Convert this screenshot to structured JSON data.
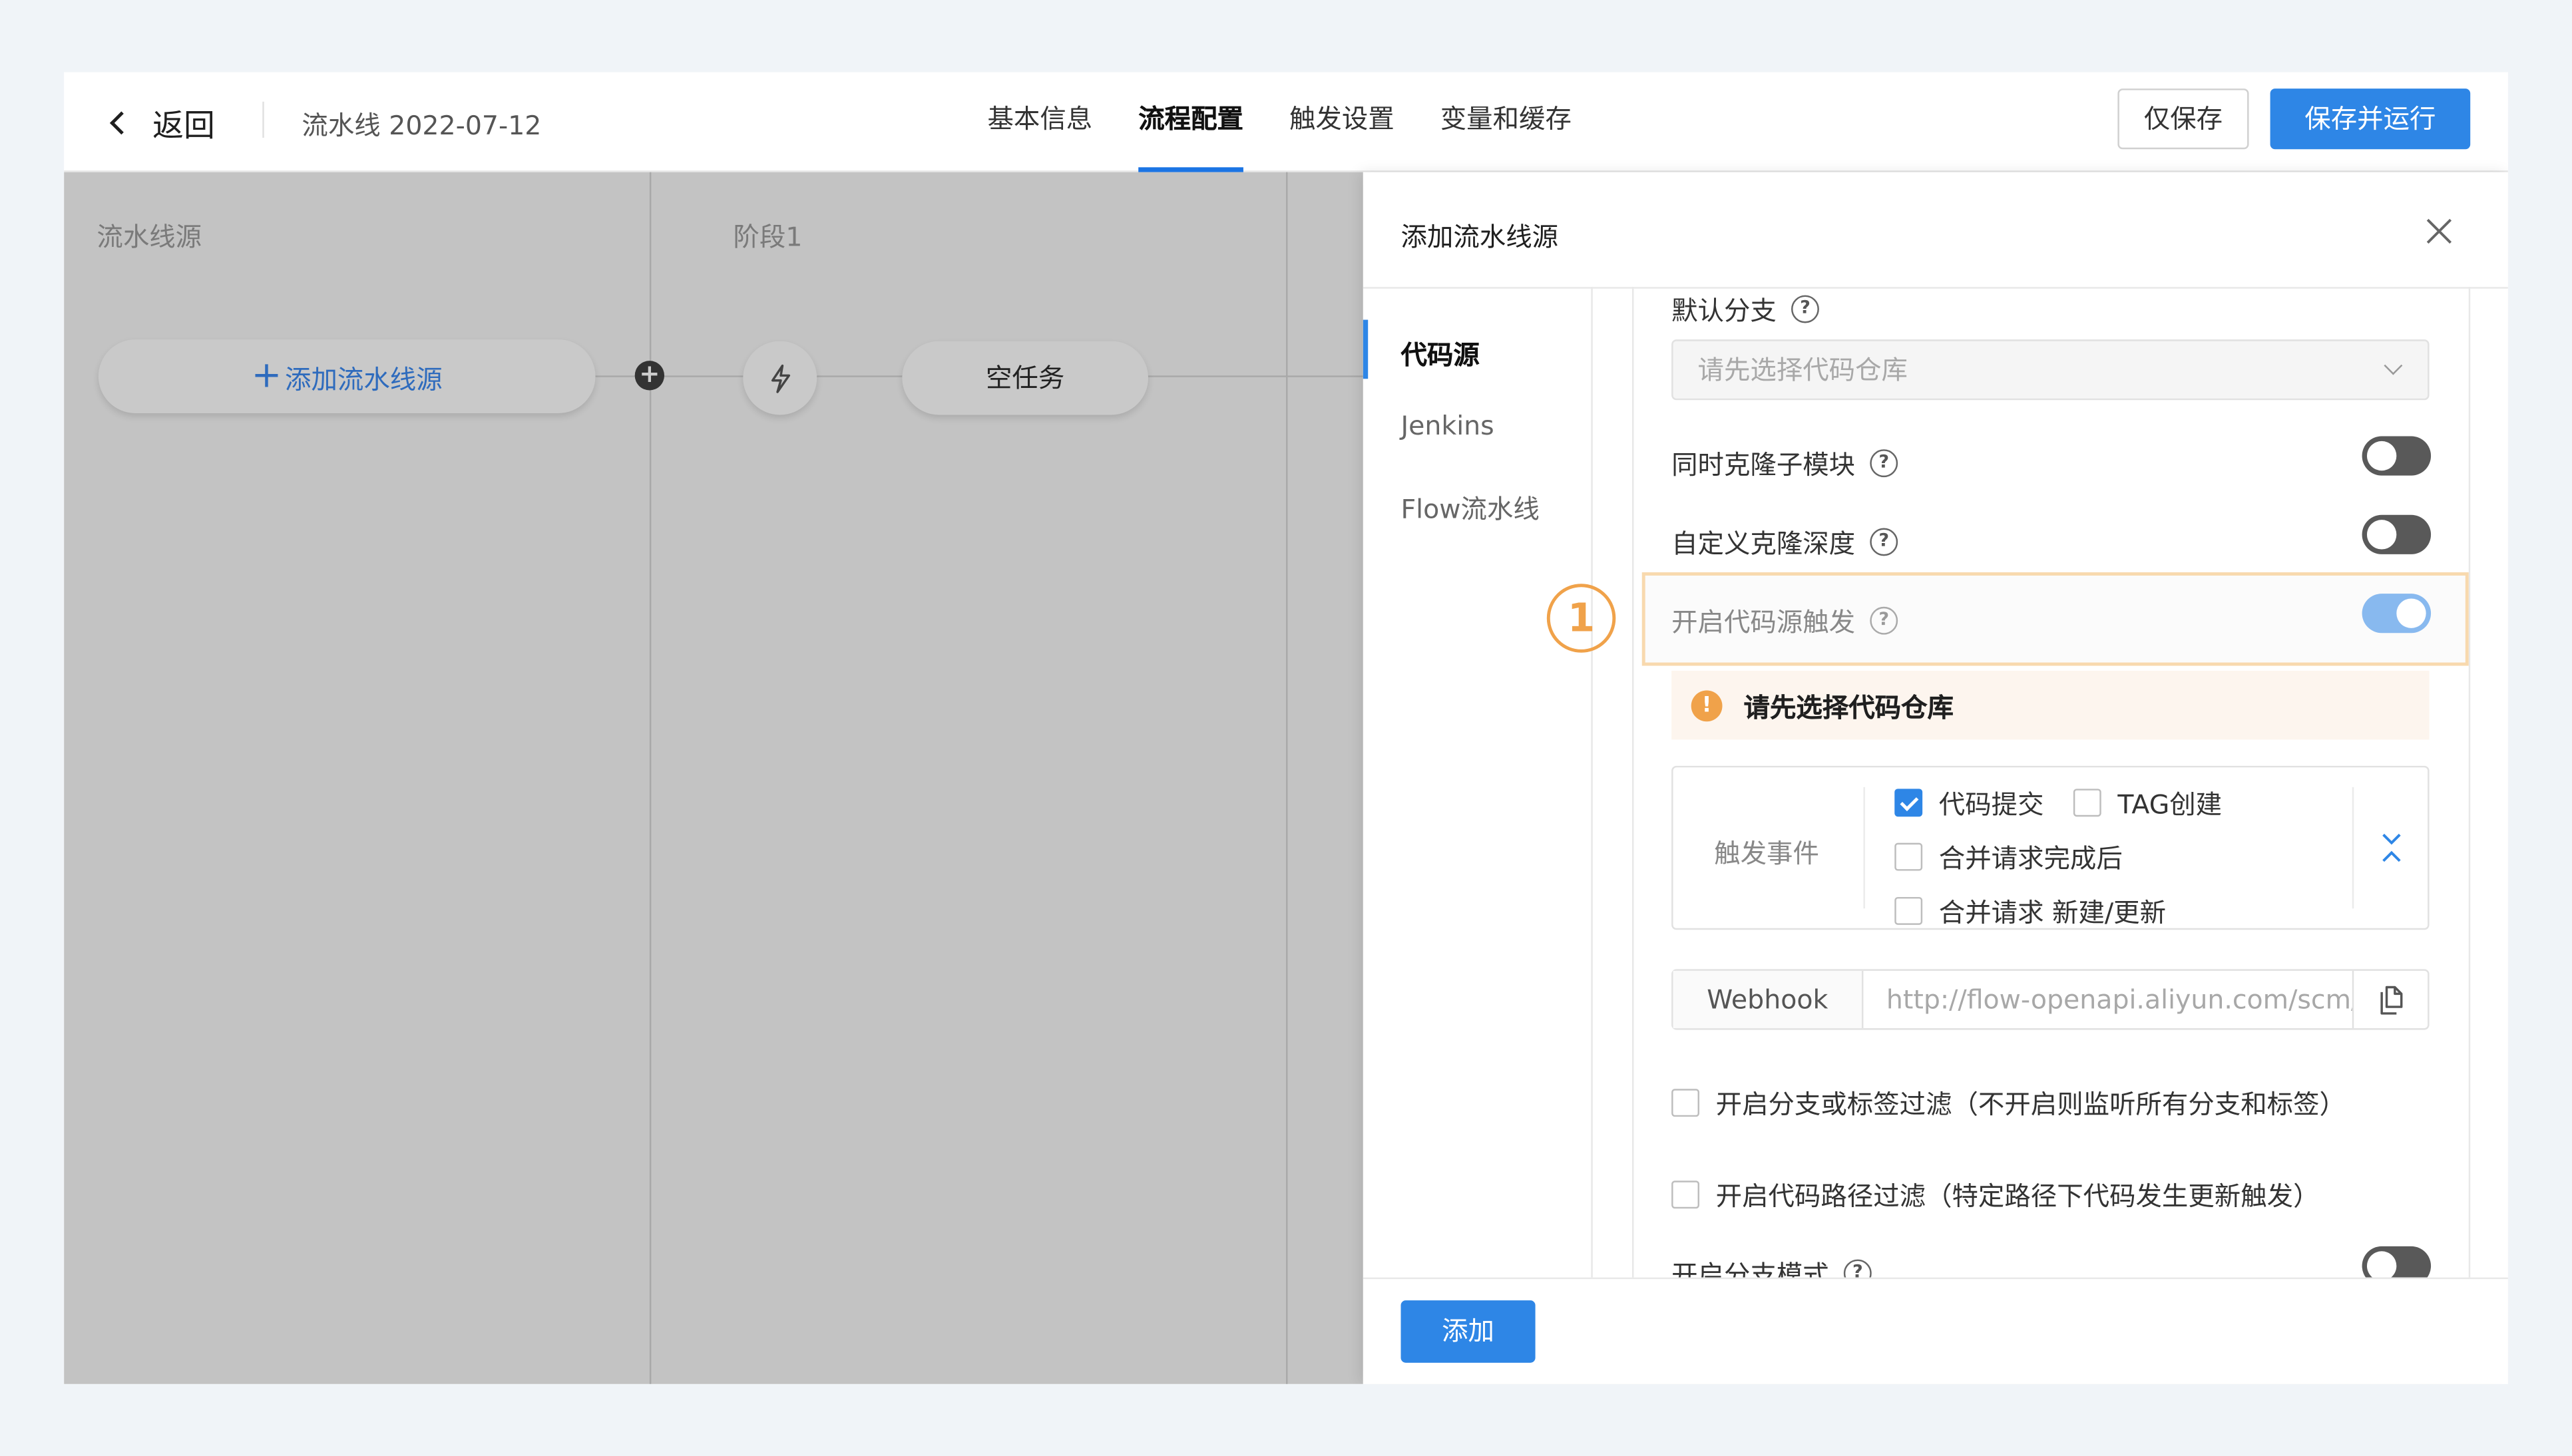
{
  "header": {
    "back_label": "返回",
    "pipeline_title": "流水线 2022-07-12",
    "tabs": [
      {
        "label": "基本信息",
        "active": false
      },
      {
        "label": "流程配置",
        "active": true
      },
      {
        "label": "触发设置",
        "active": false
      },
      {
        "label": "变量和缓存",
        "active": false
      }
    ],
    "save_only_label": "仅保存",
    "save_run_label": "保存并运行"
  },
  "canvas": {
    "source_column_title": "流水线源",
    "stage_column_title": "阶段1",
    "add_source_label": "添加流水线源",
    "empty_task_label": "空任务"
  },
  "drawer": {
    "title": "添加流水线源",
    "nav": [
      {
        "label": "代码源",
        "active": true
      },
      {
        "label": "Jenkins",
        "active": false
      },
      {
        "label": "Flow流水线",
        "active": false
      }
    ],
    "default_branch_label": "默认分支",
    "branch_select_placeholder": "请先选择代码仓库",
    "clone_submodules_label": "同时克隆子模块",
    "clone_submodules_on": false,
    "custom_clone_depth_label": "自定义克隆深度",
    "custom_clone_depth_on": false,
    "source_trigger_label": "开启代码源触发",
    "source_trigger_on": true,
    "callout_number": "1",
    "warning_text": "请先选择代码仓库",
    "trigger_events_label": "触发事件",
    "events": {
      "code_commit": {
        "label": "代码提交",
        "checked": true
      },
      "tag_create": {
        "label": "TAG创建",
        "checked": false
      },
      "merge_done": {
        "label": "合并请求完成后",
        "checked": false
      },
      "merge_new": {
        "label": "合并请求 新建/更新",
        "checked": false
      }
    },
    "webhook_label": "Webhook",
    "webhook_url": "http://flow-openapi.aliyun.com/scm/",
    "branch_tag_filter_label": "开启分支或标签过滤（不开启则监听所有分支和标签）",
    "path_filter_label": "开启代码路径过滤（特定路径下代码发生更新触发）",
    "branch_mode_label": "开启分支模式",
    "branch_mode_on": false,
    "add_button_label": "添加"
  },
  "colors": {
    "primary": "#2e86e6",
    "callout": "#f0a24a",
    "warning_bg": "#fdf5ee"
  }
}
